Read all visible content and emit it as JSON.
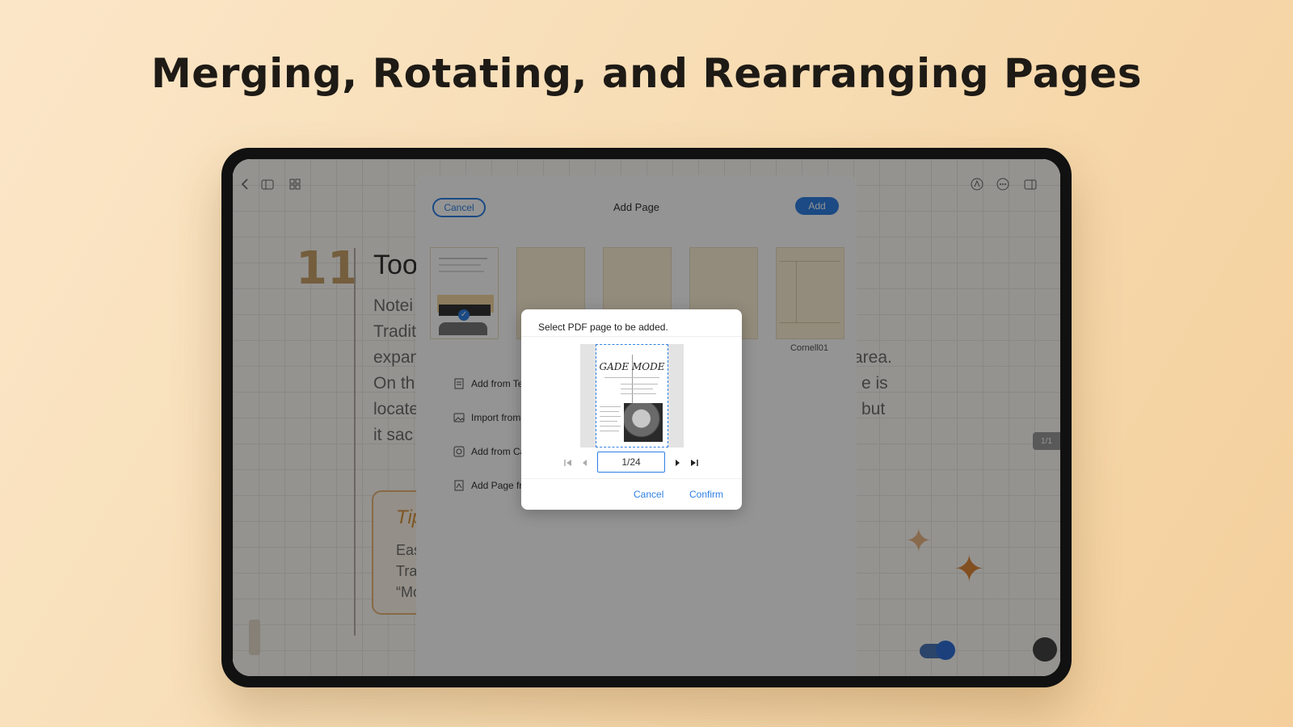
{
  "headline": "Merging, Rotating, and Rearranging Pages",
  "notebook": {
    "chapter_number": "11",
    "title": "Too",
    "paragraph_lines": [
      "Notei",
      "Tradit",
      "expan",
      "On th",
      "locate",
      "it sac"
    ],
    "right_fragments": [
      "area.",
      "e is",
      "but"
    ],
    "tip": {
      "title": "Tip",
      "lines": [
        "Eas",
        "Tra",
        "“Mo"
      ]
    },
    "side_tab": "1/1"
  },
  "add_page_sheet": {
    "cancel_label": "Cancel",
    "title": "Add Page",
    "add_label": "Add",
    "templates": [
      {
        "label": ""
      },
      {
        "label": ""
      },
      {
        "label": ""
      },
      {
        "label": ""
      },
      {
        "label": "Cornell01"
      }
    ],
    "options": [
      "Add from Ter",
      "Import from I",
      "Add from Ca",
      "Add Page fro"
    ]
  },
  "dialog": {
    "title": "Select PDF page to be added.",
    "preview_masthead": "GADE MODE",
    "page_indicator": "1/24",
    "cancel_label": "Cancel",
    "confirm_label": "Confirm"
  },
  "colors": {
    "accent": "#2f80e4",
    "headline": "#1e1a15",
    "highlight": "#e0893a"
  }
}
